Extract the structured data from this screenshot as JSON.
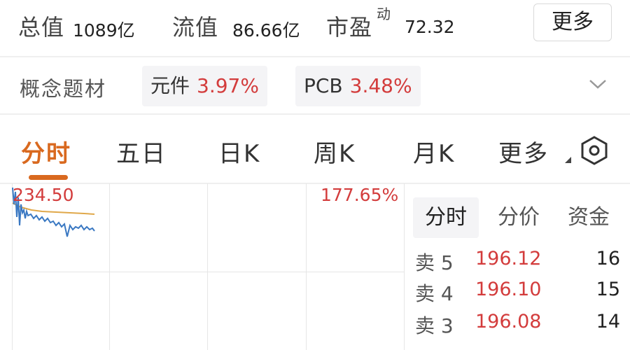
{
  "summary": {
    "total_value_label": "总值",
    "total_value": "1089亿",
    "float_value_label": "流值",
    "float_value": "86.66亿",
    "pe_label": "市盈",
    "pe_superscript": "动",
    "pe_value": "72.32",
    "more_button": "更多"
  },
  "concepts": {
    "label": "概念题材",
    "chips": [
      {
        "name": "元件",
        "pct": "3.97%"
      },
      {
        "name": "PCB",
        "pct": "3.48%"
      }
    ],
    "expand_icon": "chevron-down-icon"
  },
  "period_tabs": {
    "items": [
      "分时",
      "五日",
      "日K",
      "周K",
      "月K",
      "更多"
    ],
    "active": "分时",
    "settings_icon": "hexagon-settings-icon"
  },
  "chart": {
    "price_high": "234.50",
    "pct_high": "177.65%"
  },
  "order_panel": {
    "tabs": [
      "分时",
      "分价",
      "资金"
    ],
    "active_tab": "分时",
    "rows": [
      {
        "label": "卖 5",
        "price": "196.12",
        "volume": "16"
      },
      {
        "label": "卖 4",
        "price": "196.10",
        "volume": "15"
      },
      {
        "label": "卖 3",
        "price": "196.08",
        "volume": "14"
      }
    ]
  },
  "colors": {
    "accent": "#d9691f",
    "up": "#d33c3c",
    "price_line": "#3a78c2",
    "avg_line": "#e0a84a"
  }
}
